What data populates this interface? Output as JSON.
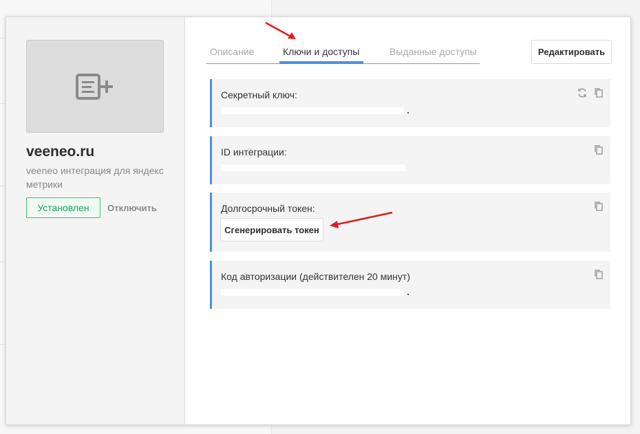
{
  "app": {
    "name": "veeneo.ru",
    "description": "veeneo интеграция для яндекс метрики",
    "status_label": "Установлен",
    "disable_label": "Отключить"
  },
  "tabs": [
    {
      "label": "Описание",
      "active": false
    },
    {
      "label": "Ключи и доступы",
      "active": true
    },
    {
      "label": "Выданные доступы",
      "active": false
    }
  ],
  "edit_label": "Редактировать",
  "cards": {
    "secret_key": {
      "title": "Секретный ключ:",
      "icons": [
        "refresh-icon",
        "copy-icon"
      ]
    },
    "integration_id": {
      "title": "ID интеграции:",
      "icons": [
        "copy-icon"
      ]
    },
    "long_token": {
      "title": "Долгосрочный токен:",
      "button_label": "Сгенерировать токен",
      "icons": [
        "copy-icon"
      ]
    },
    "auth_code": {
      "title": "Код авторизации (действителен 20 минут)",
      "icons": [
        "copy-icon"
      ]
    }
  },
  "colors": {
    "accent": "#4a8fe0",
    "installed": "#21a05b",
    "annotation_arrow": "#e01b1b"
  }
}
